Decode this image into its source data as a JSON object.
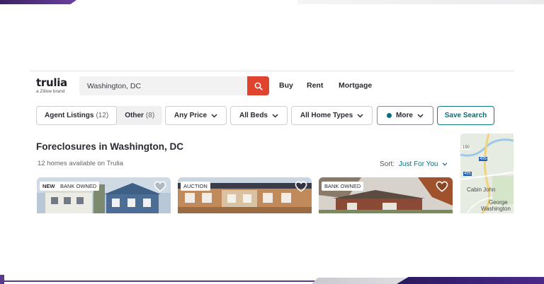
{
  "brand": {
    "name": "trulia",
    "tagline": "a Zillow brand"
  },
  "search": {
    "value": "Washington, DC"
  },
  "nav": {
    "buy": "Buy",
    "rent": "Rent",
    "mortgage": "Mortgage"
  },
  "filters": {
    "agent_listings": {
      "label": "Agent Listings",
      "count": "(12)"
    },
    "other": {
      "label": "Other",
      "count": "(8)"
    },
    "price": "Any Price",
    "beds": "All Beds",
    "home_types": "All Home Types",
    "more": "More",
    "save_search": "Save Search"
  },
  "results": {
    "title": "Foreclosures in Washington, DC",
    "count_text": "12 homes available on Trulia",
    "sort_label": "Sort:",
    "sort_value": "Just For You"
  },
  "listings": [
    {
      "badges": [
        "NEW",
        "BANK OWNED"
      ]
    },
    {
      "badges": [
        "AUCTION"
      ]
    },
    {
      "badges": [
        "BANK OWNED"
      ]
    }
  ],
  "map": {
    "labels": [
      "Cabin John",
      "George",
      "Washington"
    ],
    "route_labels": [
      "190",
      "495",
      "495"
    ]
  },
  "colors": {
    "accent_red": "#e0432e",
    "teal": "#0a6e78",
    "purple": "#4a2a8a"
  }
}
